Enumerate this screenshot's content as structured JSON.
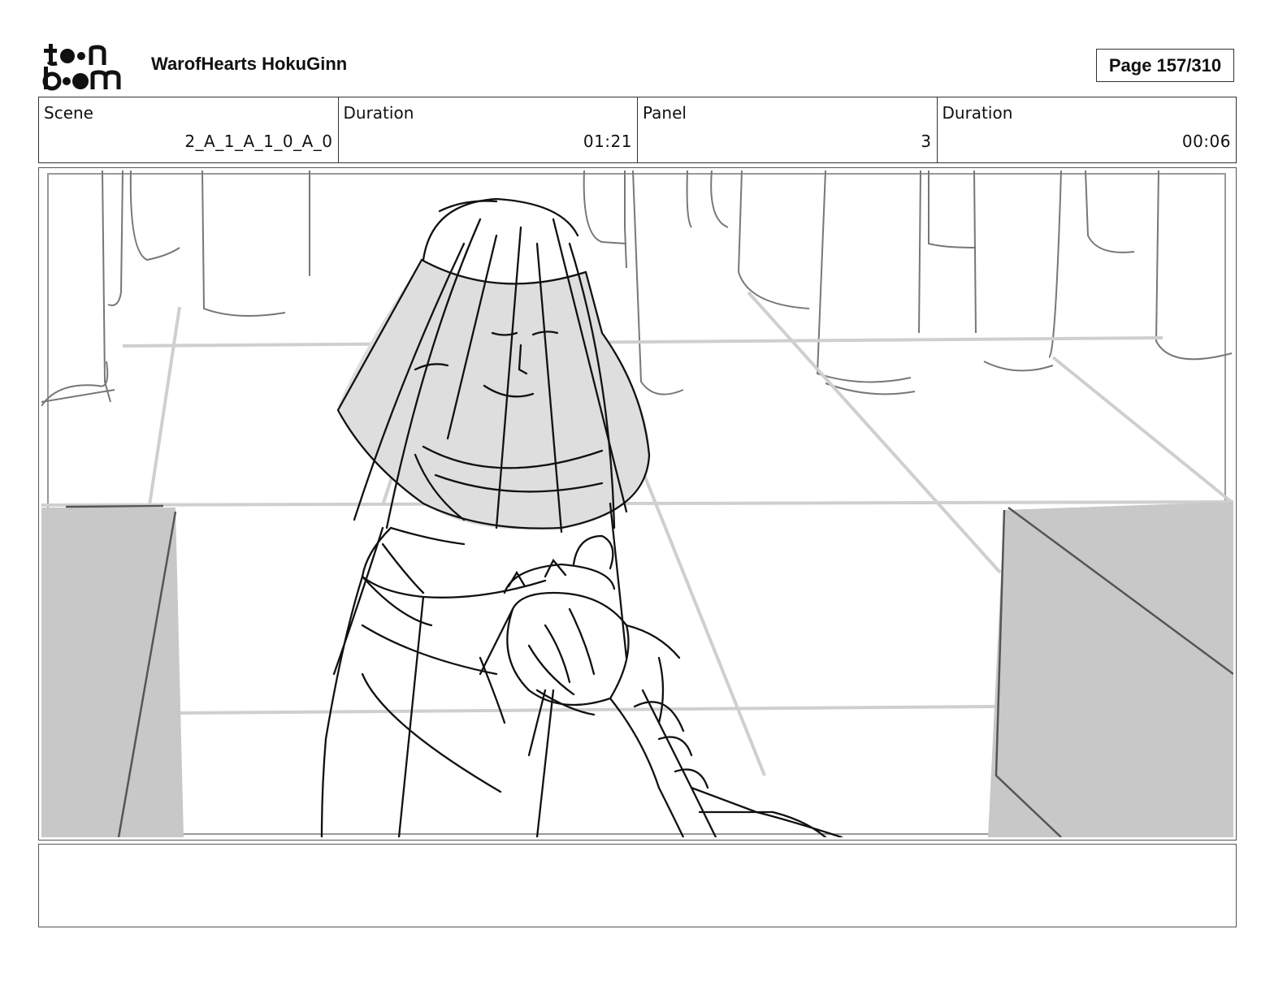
{
  "header": {
    "logo_text": "toon boom",
    "project_title": "WarofHearts HokuGinn",
    "page_label": "Page 157/310"
  },
  "info": {
    "scene_label": "Scene",
    "scene_value": "2_A_1_A_1_0_A_0",
    "scene_duration_label": "Duration",
    "scene_duration_value": "01:21",
    "panel_label": "Panel",
    "panel_value": "3",
    "panel_duration_label": "Duration",
    "panel_duration_value": "00:06"
  },
  "notes": {
    "text": ""
  }
}
